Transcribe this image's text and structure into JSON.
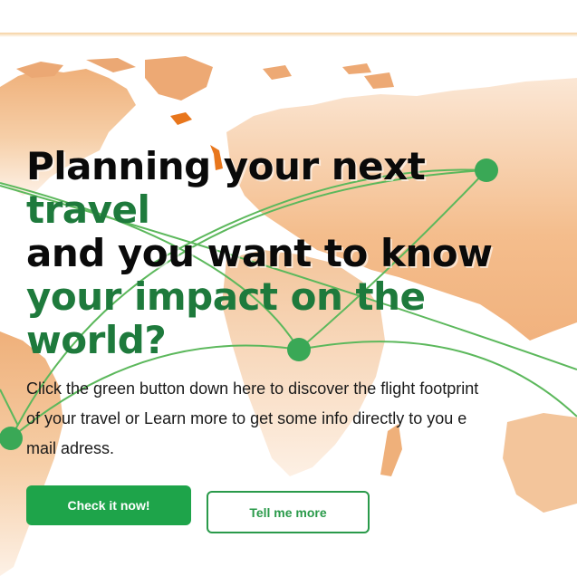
{
  "hero": {
    "title_line1": "Planning your next",
    "title_line2": "travel",
    "title_line3": "and you want to know",
    "title_line4": "your impact on the",
    "title_line5": "world?",
    "description": "Click the green button down here to discover the flight footprint of your travel or Learn more to get some info directly to you e mail adress."
  },
  "buttons": {
    "primary_label": "Check it now!",
    "secondary_label": "Tell me more"
  },
  "colors": {
    "accent_green": "#1ea44a",
    "title_green": "#1e7a3c",
    "map_orange": "#f0b27a",
    "route_green": "#5cb85c"
  },
  "icons": {
    "background": "world-map-illustration",
    "nodes": "route-node-dot"
  }
}
